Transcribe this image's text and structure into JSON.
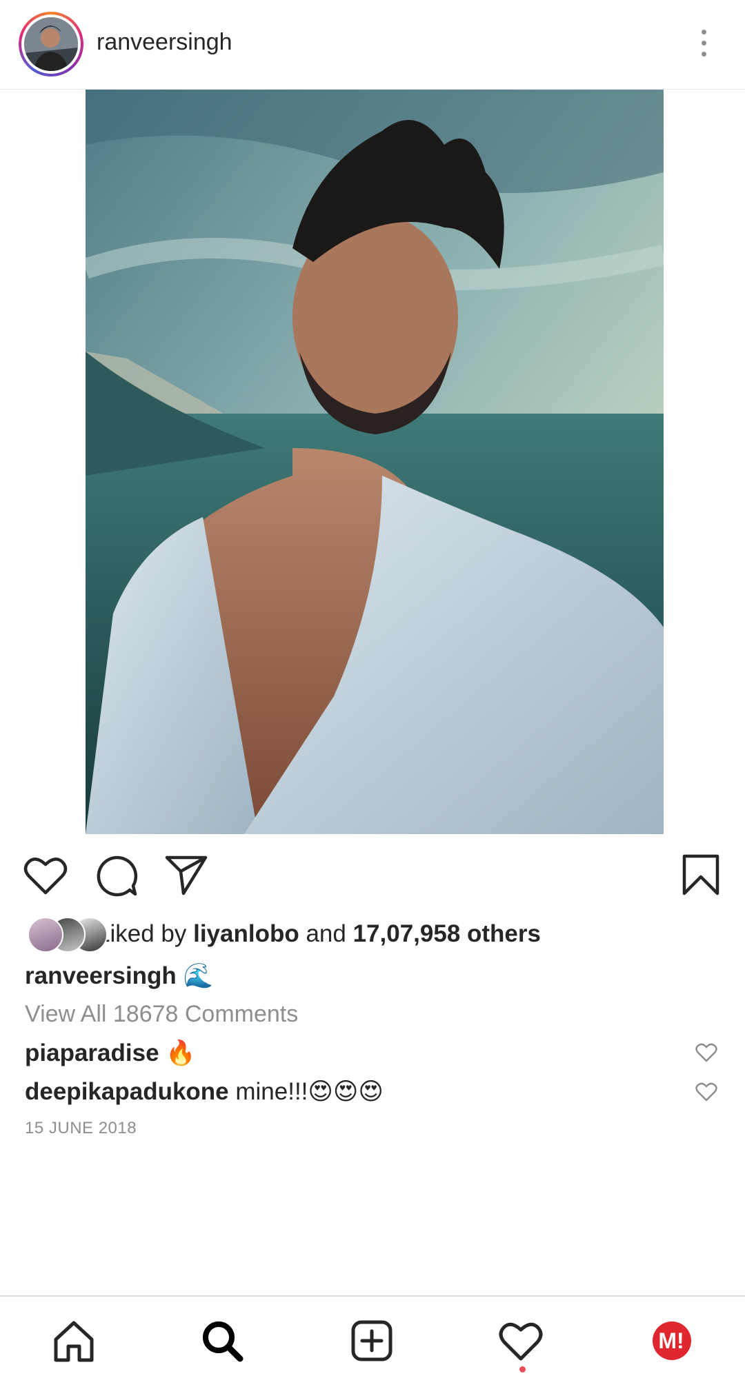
{
  "header": {
    "username": "ranveersingh",
    "more_icon": "more-vertical-icon"
  },
  "post": {
    "image_alt": "selfie of a man in an open white shirt by the sea under a cloudy sky"
  },
  "actions": {
    "like_icon": "heart-outline-icon",
    "comment_icon": "comment-bubble-icon",
    "share_icon": "send-paper-plane-icon",
    "save_icon": "bookmark-icon"
  },
  "likes": {
    "prefix": "Liked by ",
    "user": "liyanlobo",
    "connector": " and ",
    "count": "17,07,958 others"
  },
  "caption": {
    "username": "ranveersingh",
    "text": "🌊"
  },
  "comments_link": "View All 18678 Comments",
  "comments": [
    {
      "username": "piaparadise",
      "text": "🔥"
    },
    {
      "username": "deepikapadukone",
      "text": "mine!!!😍😍😍"
    }
  ],
  "date": "15 JUNE 2018",
  "nav": {
    "items": [
      "home-icon",
      "search-icon",
      "new-post-icon",
      "activity-heart-icon",
      "profile-avatar-icon"
    ],
    "active": "search-icon",
    "notification_dot_color": "#ed4956"
  },
  "colors": {
    "text": "#262626",
    "secondary": "#8e8e8e",
    "border": "#dbdbdb",
    "badge_red": "#e0272f"
  }
}
